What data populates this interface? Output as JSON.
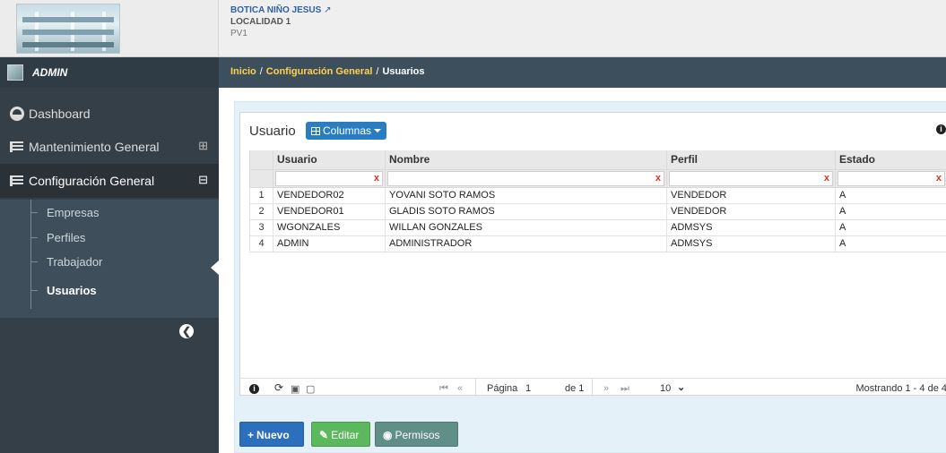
{
  "header": {
    "company": "BOTICA NIÑO JESUS",
    "external_icon": "external-link-icon",
    "location": "LOCALIDAD 1",
    "pv": "PV1"
  },
  "user": {
    "name": "ADMIN"
  },
  "breadcrumb": {
    "home": "Inicio",
    "section": "Configuración General",
    "current": "Usuarios",
    "separator": "/"
  },
  "sidebar": {
    "items": [
      {
        "label": "Dashboard",
        "icon": "dashboard-icon"
      },
      {
        "label": "Mantenimiento General",
        "icon": "list-icon",
        "toggle": "⊞"
      },
      {
        "label": "Configuración General",
        "icon": "list-icon",
        "toggle": "⊟"
      }
    ],
    "submenu": [
      "Empresas",
      "Perfiles",
      "Trabajador",
      "Usuarios"
    ],
    "collapse_icon": "arrow-left-circle-icon"
  },
  "panel": {
    "title": "Usuario",
    "columns_button": "Columnas",
    "info_icon": "info-icon"
  },
  "table": {
    "headers": [
      "Usuario",
      "Nombre",
      "Perfil",
      "Estado"
    ],
    "filter_clear": "x",
    "rows": [
      {
        "n": "1",
        "usuario": "VENDEDOR02",
        "nombre": "YOVANI SOTO RAMOS",
        "perfil": "VENDEDOR",
        "estado": "A"
      },
      {
        "n": "2",
        "usuario": "VENDEDOR01",
        "nombre": "GLADIS SOTO RAMOS",
        "perfil": "VENDEDOR",
        "estado": "A"
      },
      {
        "n": "3",
        "usuario": "WGONZALES",
        "nombre": "WILLAN GONZALES",
        "perfil": "ADMSYS",
        "estado": "A"
      },
      {
        "n": "4",
        "usuario": "ADMIN",
        "nombre": "ADMINISTRADOR",
        "perfil": "ADMSYS",
        "estado": "A"
      }
    ]
  },
  "pager": {
    "pagina_label": "Página",
    "page": "1",
    "de_label": "de 1",
    "page_size": "10",
    "showing": "Mostrando 1 - 4 de 4"
  },
  "actions": {
    "nuevo": "Nuevo",
    "editar": "Editar",
    "permisos": "Permisos"
  },
  "colors": {
    "sidebar": "#353f47",
    "breadcrumb_bar": "#3d4f5c",
    "primary": "#2b6fbd",
    "success": "#5cb85c",
    "teal": "#5f8f87",
    "filter_x": "#d9361e"
  }
}
